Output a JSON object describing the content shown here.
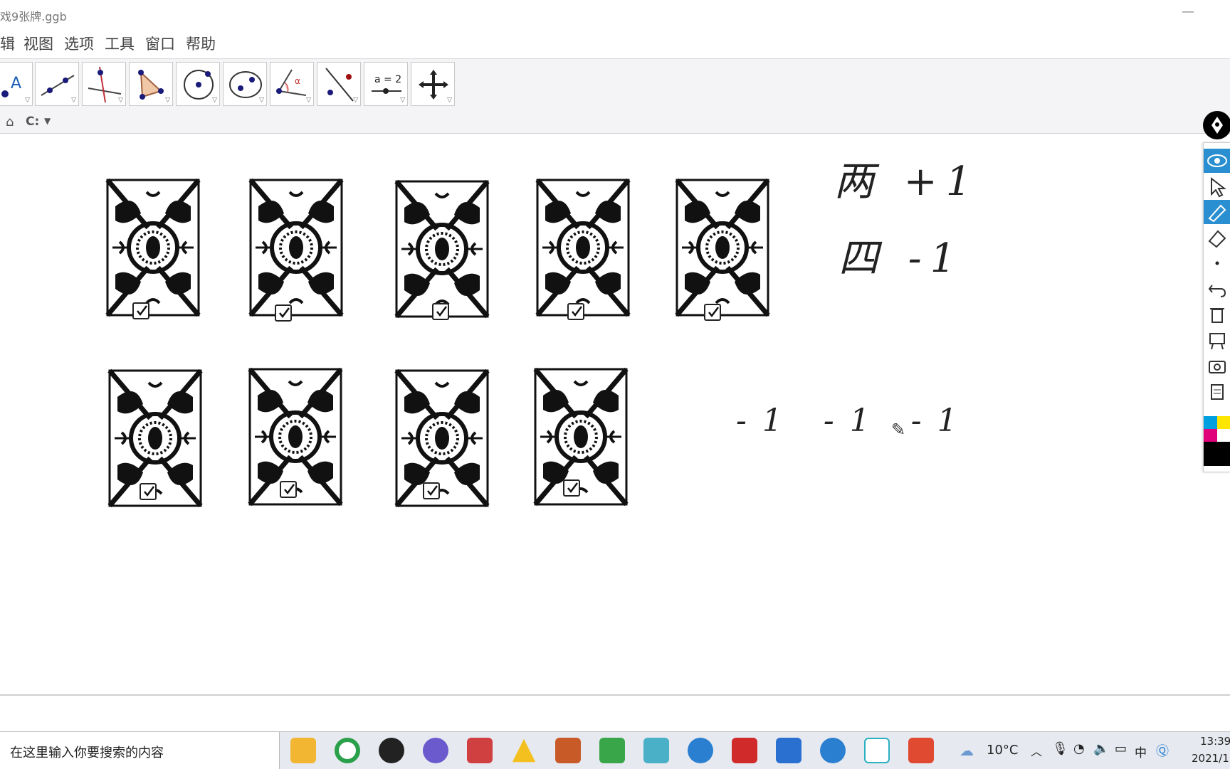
{
  "window": {
    "title": "戏9张牌.ggb",
    "minimize_glyph": "—",
    "close_glyph": "✕"
  },
  "menu": [
    "辑",
    "视图",
    "选项",
    "工具",
    "窗口",
    "帮助"
  ],
  "toolbar": {
    "tools": [
      "point-tool",
      "line-tool",
      "perpendicular-line-tool",
      "polygon-tool",
      "circle-tool",
      "conic-tool",
      "angle-tool",
      "reflect-tool",
      "slider-tool",
      "move-graphics-view-tool"
    ],
    "slider_label": "a = 2"
  },
  "navbar": {
    "path": "C:"
  },
  "cards": {
    "count": 9,
    "pattern": "card-back-pattern",
    "checked": [
      true,
      true,
      true,
      true,
      true,
      true,
      true,
      true,
      true
    ]
  },
  "handwriting": {
    "line1": "两 +1",
    "line2": "四 -1",
    "line3": "-1 -1 -1"
  },
  "colors": {
    "accent": "#1a9ad6",
    "card_ink": "#111111",
    "toolbar_bg": "#f4f4f6",
    "taskbar_bg": "#e6e9ef"
  },
  "taskbar": {
    "search_placeholder": "在这里输入你要搜索的内容",
    "weather": "10°C",
    "ime": "中",
    "time": "13:39",
    "date": "2021/1"
  }
}
